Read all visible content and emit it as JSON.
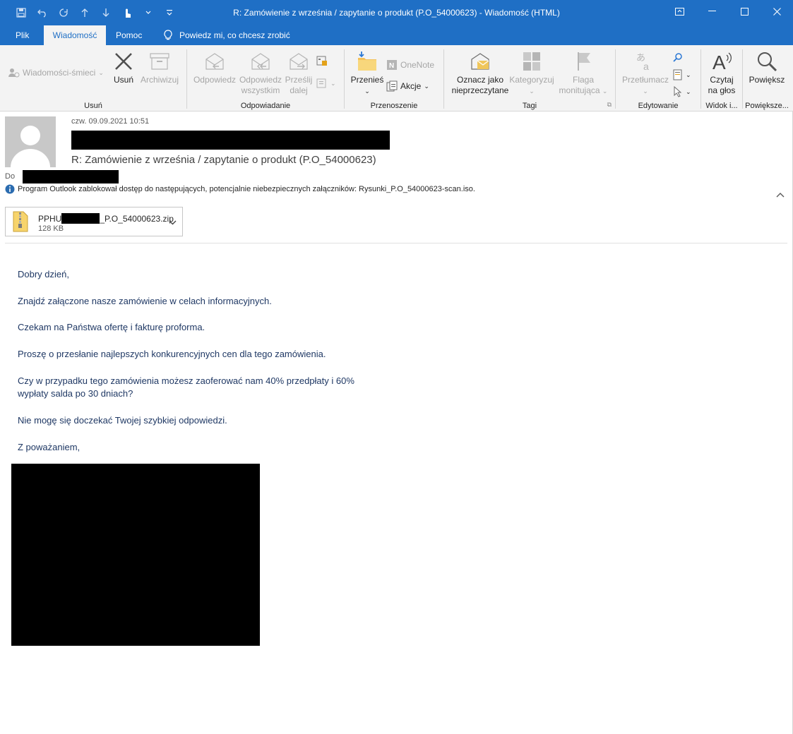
{
  "window": {
    "title": "R: Zamówienie z września / zapytanie o produkt (P.O_54000623)  -  Wiadomość (HTML)"
  },
  "menu": {
    "tabs": [
      "Plik",
      "Wiadomość",
      "Pomoc"
    ],
    "active_tab": "Wiadomość",
    "tell_me": "Powiedz mi, co chcesz zrobić"
  },
  "ribbon": {
    "usun": {
      "label": "Usuń",
      "junk": "Wiadomości-śmieci",
      "delete": "Usuń",
      "archive": "Archiwizuj"
    },
    "odpowiadanie": {
      "label": "Odpowiadanie",
      "reply": [
        "Odpowiedz"
      ],
      "reply_all": [
        "Odpowiedz",
        "wszystkim"
      ],
      "forward": [
        "Prześlij",
        "dalej"
      ]
    },
    "przenoszenie": {
      "label": "Przenoszenie",
      "move": "Przenieś",
      "onenote": "OneNote",
      "actions": "Akcje"
    },
    "tagi": {
      "label": "Tagi",
      "mark_unread": [
        "Oznacz jako",
        "nieprzeczytane"
      ],
      "categorize": "Kategoryzuj",
      "flag": [
        "Flaga",
        "monitująca"
      ]
    },
    "edytowanie": {
      "label": "Edytowanie",
      "translate": "Przetłumacz"
    },
    "widok": {
      "label": "Widok i...",
      "read_aloud": [
        "Czytaj",
        "na głos"
      ]
    },
    "powieksz": {
      "label": "Powiększe...",
      "zoom": "Powiększ"
    }
  },
  "message": {
    "date": "czw. 09.09.2021 10:51",
    "subject": "R: Zamówienie z września / zapytanie o produkt (P.O_54000623)",
    "to_label": "Do",
    "info": "Program Outlook zablokował dostęp do następujących, potencjalnie niebezpiecznych załączników: Rysunki_P.O_54000623-scan.iso.",
    "attachment": {
      "name_prefix": "PPHU",
      "name_suffix": "_P.O_54000623.zip",
      "size": "128 KB"
    },
    "body": [
      "Dobry dzień,",
      "Znajdź załączone nasze zamówienie w celach informacyjnych.",
      "Czekam na Państwa ofertę i fakturę proforma.",
      "Proszę o przesłanie najlepszych konkurencyjnych cen dla tego zamówienia.",
      "Czy w przypadku tego zamówienia możesz zaoferować nam 40% przedpłaty i 60%",
      "wypłaty salda po 30 dniach?",
      "Nie mogę się doczekać Twojej szybkiej odpowiedzi.",
      "Z poważaniem,"
    ]
  },
  "colors": {
    "titlebar": "#1f6fc5",
    "ribbon": "#f3f3f3",
    "body_text": "#1f3864"
  }
}
